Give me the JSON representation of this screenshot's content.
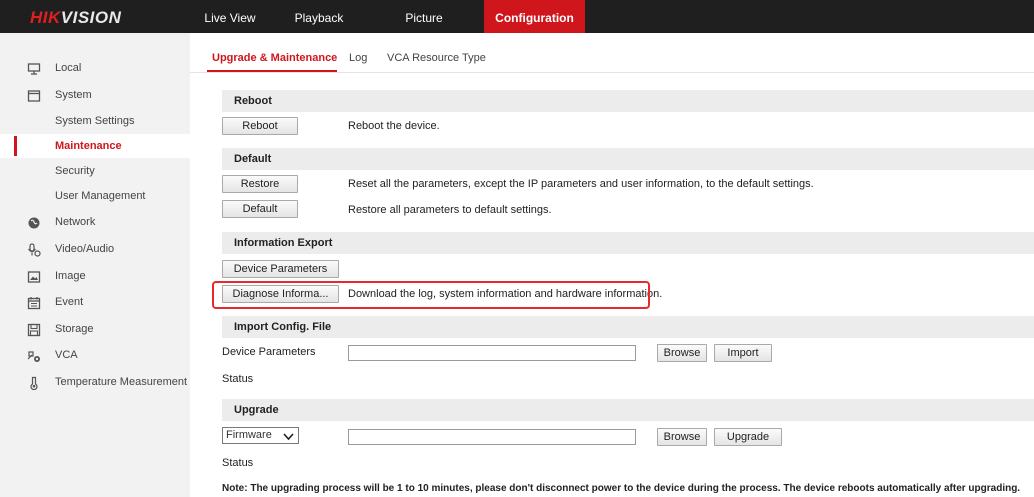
{
  "header": {
    "logo_hik": "HIK",
    "logo_vision": "VISION",
    "nav": [
      {
        "label": "Live View"
      },
      {
        "label": "Playback"
      },
      {
        "label": "Picture"
      },
      {
        "label": "Configuration"
      }
    ],
    "active_color": "#d0161d"
  },
  "sidebar": {
    "items": [
      {
        "label": "Local",
        "icon": "monitor-icon"
      },
      {
        "label": "System",
        "icon": "window-icon"
      },
      {
        "label": "System Settings"
      },
      {
        "label": "Maintenance"
      },
      {
        "label": "Security"
      },
      {
        "label": "User Management"
      },
      {
        "label": "Network",
        "icon": "globe-icon"
      },
      {
        "label": "Video/Audio",
        "icon": "microphone-icon"
      },
      {
        "label": "Image",
        "icon": "image-icon"
      },
      {
        "label": "Event",
        "icon": "calendar-icon"
      },
      {
        "label": "Storage",
        "icon": "floppy-icon"
      },
      {
        "label": "VCA",
        "icon": "vca-icon"
      },
      {
        "label": "Temperature Measurement",
        "icon": "thermometer-icon"
      }
    ]
  },
  "tabs": [
    {
      "label": "Upgrade & Maintenance"
    },
    {
      "label": "Log"
    },
    {
      "label": "VCA Resource Type"
    }
  ],
  "reboot": {
    "title": "Reboot",
    "button": "Reboot",
    "desc": "Reboot the device."
  },
  "default": {
    "title": "Default",
    "restore_button": "Restore",
    "restore_desc": "Reset all the parameters, except the IP parameters and user information, to the default settings.",
    "default_button": "Default",
    "default_desc": "Restore all parameters to default settings."
  },
  "export": {
    "title": "Information Export",
    "device_params_button": "Device Parameters",
    "diagnose_button": "Diagnose Informa...",
    "diagnose_desc": "Download the log, system information and hardware information."
  },
  "import_config": {
    "title": "Import Config. File",
    "label": "Device Parameters",
    "file_value": "",
    "browse_button": "Browse",
    "import_button": "Import",
    "status_label": "Status"
  },
  "upgrade": {
    "title": "Upgrade",
    "select_value": "Firmware",
    "file_value": "",
    "browse_button": "Browse",
    "upgrade_button": "Upgrade",
    "status_label": "Status",
    "note": "Note: The upgrading process will be 1 to 10 minutes, please don't disconnect power to the device during the process. The device reboots automatically after upgrading."
  }
}
